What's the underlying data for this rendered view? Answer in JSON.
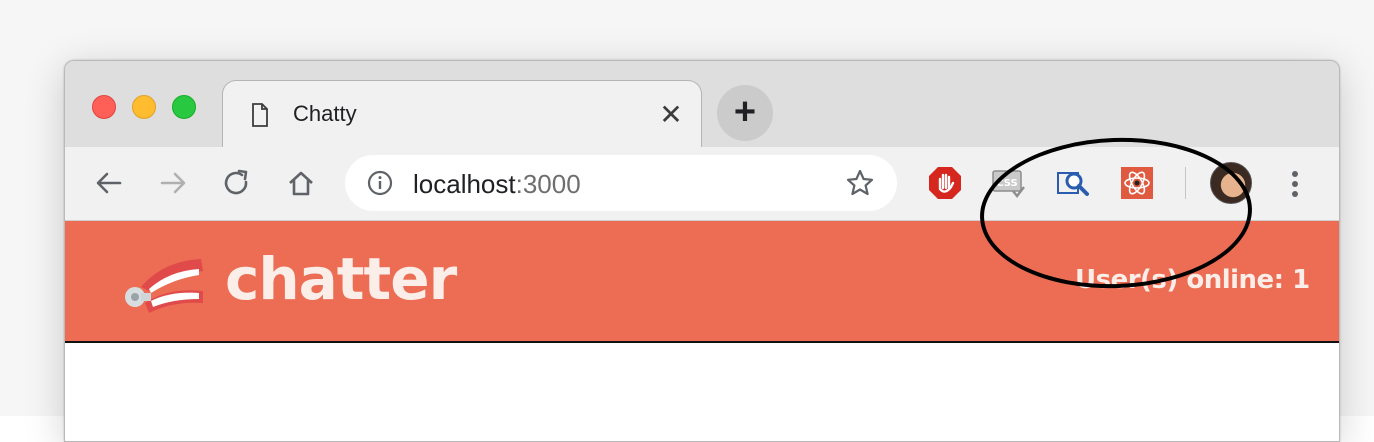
{
  "browser": {
    "tab_title": "Chatty",
    "tab_close_symbol": "✕",
    "new_tab_symbol": "+",
    "address": {
      "host": "localhost",
      "port": ":3000"
    },
    "icons": {
      "tab_favicon": "page-icon",
      "back": "arrow-left-icon",
      "forward": "arrow-right-icon",
      "reload": "reload-icon",
      "home": "home-icon",
      "site_info": "info-icon",
      "bookmark": "star-icon",
      "menu": "kebab-menu-icon"
    },
    "extensions": [
      {
        "name": "adblock-icon",
        "color": "#d5271e"
      },
      {
        "name": "css-viewer-icon",
        "label": "CSS",
        "color": "#9e9e9e"
      },
      {
        "name": "search-inspect-icon",
        "color": "#2a5db0"
      },
      {
        "name": "react-devtools-icon",
        "color": "#e05a3f"
      }
    ]
  },
  "app": {
    "brand": "chatter",
    "online_label": "User(s) online: 1",
    "colors": {
      "header": "#ec6d53",
      "header_text": "#fbeee9"
    }
  }
}
